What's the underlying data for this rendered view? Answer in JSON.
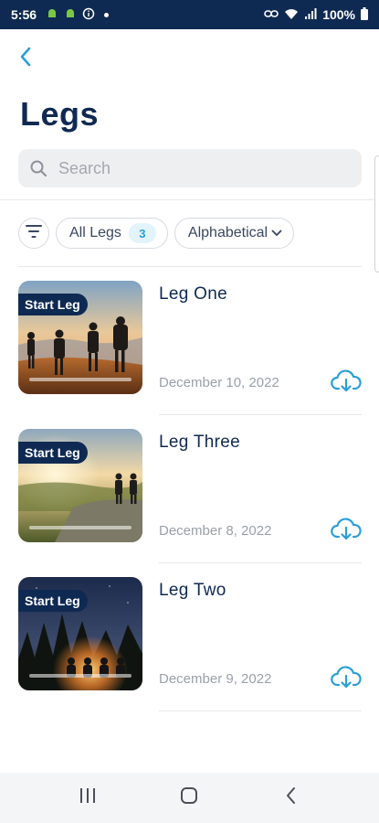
{
  "status_bar": {
    "time": "5:56",
    "battery": "100%"
  },
  "header": {
    "title": "Legs",
    "back_icon": "chevron-left-icon"
  },
  "search": {
    "placeholder": "Search",
    "value": ""
  },
  "filters": {
    "all_legs_label": "All Legs",
    "all_legs_count": "3",
    "sort_label": "Alphabetical"
  },
  "legs": [
    {
      "title": "Leg One",
      "date": "December 10, 2022",
      "badge": "Start Leg",
      "scene": "hikers-sunset"
    },
    {
      "title": "Leg Three",
      "date": "December 8, 2022",
      "badge": "Start Leg",
      "scene": "valley-sunrise"
    },
    {
      "title": "Leg Two",
      "date": "December 9, 2022",
      "badge": "Start Leg",
      "scene": "campfire-night"
    }
  ],
  "colors": {
    "primary": "#0f2a52",
    "accent": "#2a9fd6",
    "muted": "#9aa0a8"
  }
}
